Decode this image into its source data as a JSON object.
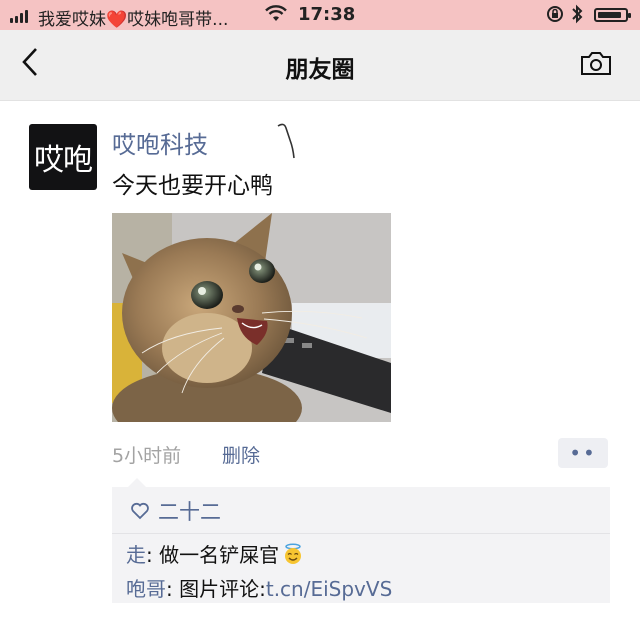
{
  "status_bar": {
    "carrier": "我爱哎妹❤️哎妹咆哥带...",
    "time": "17:38",
    "battery_level": 0.9
  },
  "nav": {
    "title": "朋友圈",
    "back_icon": "chevron-left-icon",
    "camera_icon": "camera-icon"
  },
  "post": {
    "avatar_text": "哎咆",
    "username": "哎咆科技",
    "text": "今天也要开心鸭",
    "image": "kitten-photo",
    "time": "5小时前",
    "delete_label": "删除",
    "more_label": "••"
  },
  "interactions": {
    "likes": "二十二",
    "comments": [
      {
        "name": "走",
        "sep": ": ",
        "text": "做一名铲屎官",
        "emoji": "face-with-halo-emoji"
      },
      {
        "name": "咆哥",
        "sep": ": ",
        "text": "图片评论:",
        "link": "t.cn/EiSpvVS"
      }
    ]
  },
  "colors": {
    "status_bar_bg": "#f5c3c3",
    "nav_bg": "#efefef",
    "link_blue": "#576b95",
    "comment_box_bg": "#f3f3f5"
  }
}
